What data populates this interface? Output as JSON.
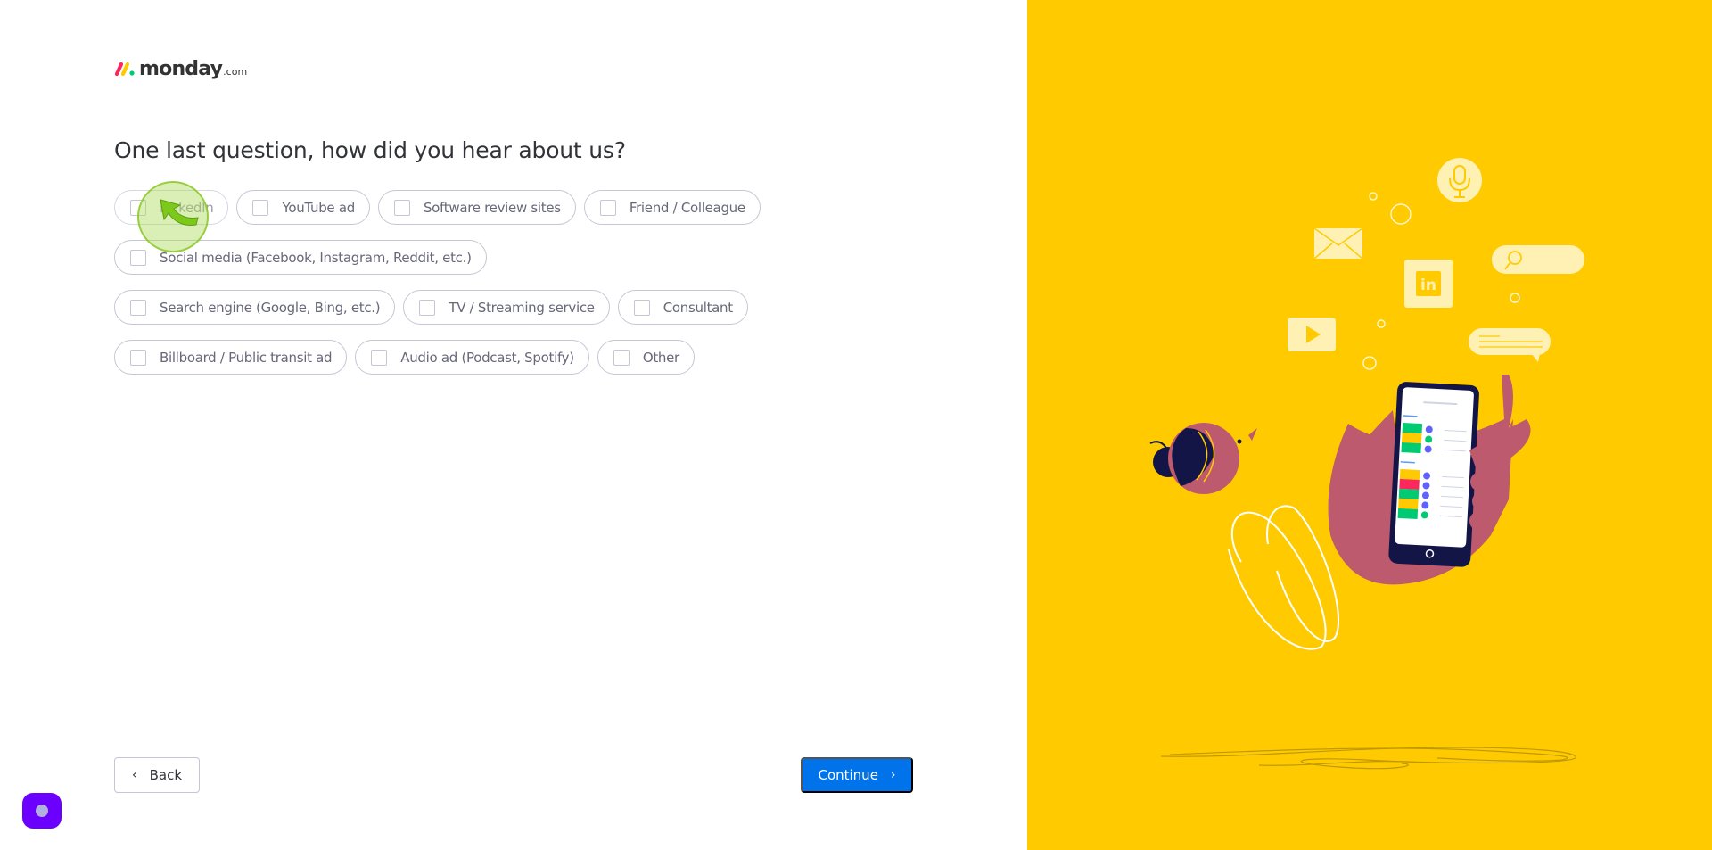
{
  "brand": {
    "name": "monday",
    "tld": ".com",
    "colors": {
      "red": "#fb275d",
      "yellow": "#ffcb00",
      "green": "#00ca72"
    }
  },
  "question": {
    "title": "One last question, how did you hear about us?"
  },
  "options": [
    {
      "label": "LinkedIn",
      "checked": false,
      "state": "hover"
    },
    {
      "label": "YouTube ad",
      "checked": false
    },
    {
      "label": "Software review sites",
      "checked": false
    },
    {
      "label": "Friend / Colleague",
      "checked": false
    },
    {
      "label": "Social media (Facebook, Instagram, Reddit, etc.)",
      "checked": false
    },
    {
      "label": "Search engine (Google, Bing, etc.)",
      "checked": false
    },
    {
      "label": "TV / Streaming service",
      "checked": false
    },
    {
      "label": "Consultant",
      "checked": false
    },
    {
      "label": "Billboard / Public transit ad",
      "checked": false
    },
    {
      "label": "Audio ad (Podcast, Spotify)",
      "checked": false
    },
    {
      "label": "Other",
      "checked": false
    }
  ],
  "navigation": {
    "back_label": "Back",
    "back_icon": "chevron-left-icon",
    "continue_label": "Continue",
    "continue_icon": "chevron-right-icon"
  },
  "theme": {
    "primary": "#0073ea",
    "panel": "#ffcb00",
    "widget": "#6c00ff"
  },
  "illustration": {
    "icons": [
      "microphone-icon",
      "envelope-icon",
      "linkedin-icon",
      "search-bar-icon",
      "play-video-icon",
      "chat-bubble-icon"
    ],
    "status_colors": [
      "#00ca72",
      "#ffcb00",
      "#00ca72",
      "#ffcb00",
      "#fb275d",
      "#00ca72",
      "#ffcb00",
      "#00ca72"
    ]
  }
}
